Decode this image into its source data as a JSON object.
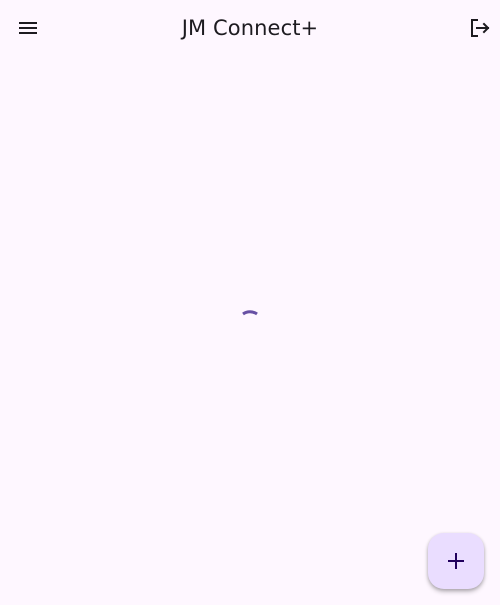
{
  "app_bar": {
    "title": "JM Connect+",
    "menu_icon": "hamburger-menu-icon",
    "logout_icon": "logout-icon"
  },
  "main": {
    "loading_indicator": "circular-progress-spinner"
  },
  "fab": {
    "icon": "plus-icon"
  },
  "colors": {
    "background": "#fef7ff",
    "accent": "#6750a4",
    "fab_background": "#eaddff",
    "text": "#1d1b20"
  }
}
